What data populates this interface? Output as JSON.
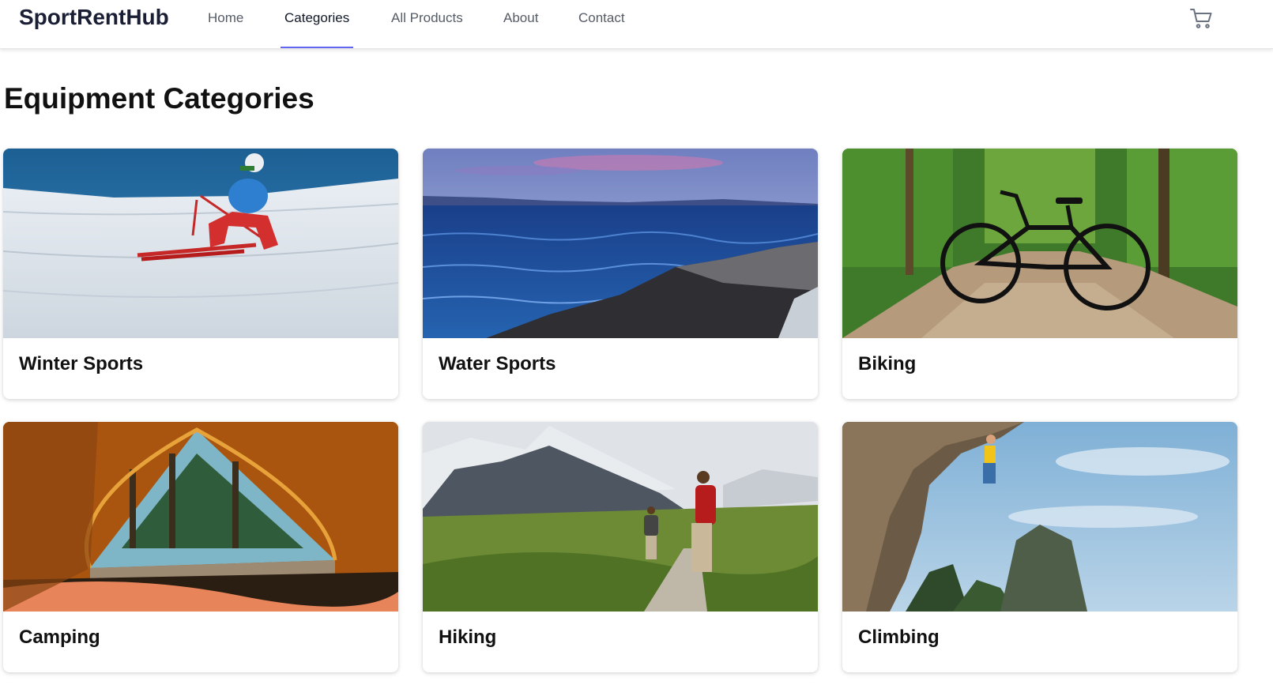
{
  "nav": {
    "brand": "SportRentHub",
    "links": [
      "Home",
      "Categories",
      "All Products",
      "About",
      "Contact"
    ],
    "active": "Categories",
    "accent_color": "#6366f1",
    "cart_icon": "shopping-cart-icon"
  },
  "page": {
    "title": "Equipment Categories"
  },
  "categories": [
    {
      "name": "Winter Sports"
    },
    {
      "name": "Water Sports"
    },
    {
      "name": "Biking"
    },
    {
      "name": "Camping"
    },
    {
      "name": "Hiking"
    },
    {
      "name": "Climbing"
    }
  ]
}
